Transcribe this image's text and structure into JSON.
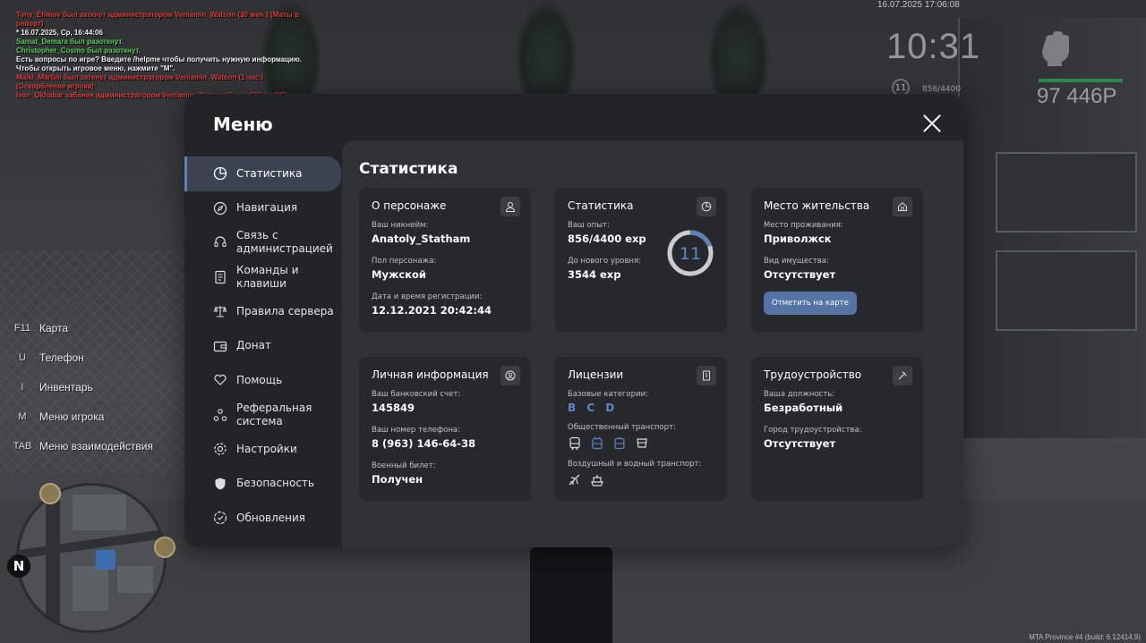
{
  "chat": [
    {
      "color": "red",
      "text": "Tony_Efimov был заткнут администратором Veniamin_Watson (30 мин.) (Маты в репорт)"
    },
    {
      "color": "white",
      "text": "* 16.07.2025, Ср, 16:44:06"
    },
    {
      "color": "green",
      "text": "Samat_Demara был разоткнут."
    },
    {
      "color": "green",
      "text": "Christopher_Cosmo был разоткнут."
    },
    {
      "color": "white",
      "text": "Есть вопросы по игре? Введите /helpme чтобы получить нужную информацию."
    },
    {
      "color": "white",
      "text": "Чтобы открыть игровое меню, нажмите \"M\"."
    },
    {
      "color": "red",
      "text": "Maikl_Martini был заткнут администратором Veniamin_Watson (1 час.) (Оскорбление игрока)"
    },
    {
      "color": "red",
      "text": "Ivan_Okhabar забанен администратором Veniamin_Watson (3 дн.) (PG by GS)"
    }
  ],
  "hud": {
    "datetime": "16.07.2025 17:06:08",
    "time": "10:31",
    "level": "11",
    "exp": "856/4400",
    "money": "97 446Р",
    "build": "MTA Province #4 (build: 6.12414.9)"
  },
  "hints": [
    {
      "key": "F11",
      "label": "Карта"
    },
    {
      "key": "U",
      "label": "Телефон"
    },
    {
      "key": "I",
      "label": "Инвентарь"
    },
    {
      "key": "M",
      "label": "Меню игрока"
    },
    {
      "key": "TAB",
      "label": "Меню взаимодействия"
    }
  ],
  "minimap": {
    "north": "N"
  },
  "menu": {
    "title": "Меню",
    "nav": [
      {
        "label": "Статистика",
        "icon": "pie-chart-icon",
        "active": true
      },
      {
        "label": "Навигация",
        "icon": "compass-icon"
      },
      {
        "label": "Связь с администрацией",
        "icon": "headset-icon"
      },
      {
        "label": "Команды и клавиши",
        "icon": "document-icon"
      },
      {
        "label": "Правила сервера",
        "icon": "scales-icon"
      },
      {
        "label": "Донат",
        "icon": "wallet-icon"
      },
      {
        "label": "Помощь",
        "icon": "heart-hand-icon"
      },
      {
        "label": "Реферальная система",
        "icon": "referral-icon"
      },
      {
        "label": "Настройки",
        "icon": "gear-icon"
      },
      {
        "label": "Безопасность",
        "icon": "shield-icon"
      },
      {
        "label": "Обновления",
        "icon": "update-icon"
      }
    ],
    "content_title": "Статистика",
    "cards": {
      "character": {
        "title": "О персонаже",
        "nickname_label": "Ваш никнейм:",
        "nickname": "Anatoly_Statham",
        "gender_label": "Пол персонажа:",
        "gender": "Мужской",
        "reg_label": "Дата и время регистрации:",
        "reg": "12.12.2021 20:42:44"
      },
      "stats": {
        "title": "Статистика",
        "exp_label": "Ваш опыт:",
        "exp": "856/4400 exp",
        "next_label": "До нового уровня:",
        "next": "3544 exp",
        "level": "11",
        "level_progress": 0.195
      },
      "residence": {
        "title": "Место жительства",
        "place_label": "Место проживания:",
        "place": "Приволжск",
        "property_label": "Вид имущества:",
        "property": "Отсутствует",
        "button": "Отметить на карте"
      },
      "personal": {
        "title": "Личная информация",
        "bank_label": "Ваш банковский счет:",
        "bank": "145849",
        "phone_label": "Ваш номер телефона:",
        "phone": "8 (963) 146-64-38",
        "military_label": "Военный билет:",
        "military": "Получен"
      },
      "licenses": {
        "title": "Лицензии",
        "base_label": "Базовые категории:",
        "base": "B C D",
        "public_label": "Общественный транспорт:",
        "air_label": "Воздушный и водный транспорт:"
      },
      "employment": {
        "title": "Трудоустройство",
        "position_label": "Ваша должность:",
        "position": "Безработный",
        "city_label": "Город трудоустройства:",
        "city": "Отсутствует"
      }
    }
  },
  "colors": {
    "accent": "#5f7fb5",
    "button": "#5574a5",
    "letters": "#5f86c8"
  }
}
